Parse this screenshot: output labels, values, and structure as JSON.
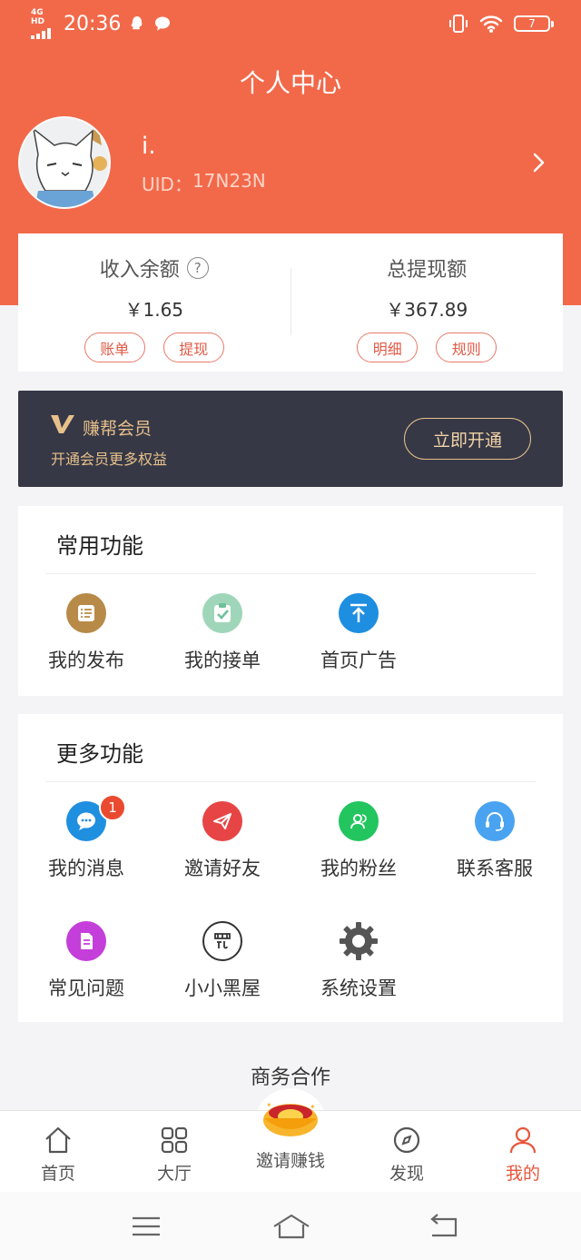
{
  "status_bar": {
    "network": "4G HD",
    "time": "20:36",
    "battery": "7"
  },
  "header": {
    "title": "个人中心"
  },
  "profile": {
    "name": "i.",
    "uid_label": "UID：",
    "uid": "17N23N"
  },
  "balance": {
    "income_label": "收入余额",
    "income_value": "￥1.65",
    "income_btn_bill": "账单",
    "income_btn_withdraw": "提现",
    "total_label": "总提现额",
    "total_value": "￥367.89",
    "total_btn_detail": "明细",
    "total_btn_rules": "规则"
  },
  "vip": {
    "title": "赚帮会员",
    "subtitle": "开通会员更多权益",
    "button": "立即开通"
  },
  "common": {
    "title": "常用功能",
    "items": [
      {
        "label": "我的发布",
        "icon": "list-icon",
        "color": "#b88a48"
      },
      {
        "label": "我的接单",
        "icon": "clipboard-check-icon",
        "color": "#6fc09b"
      },
      {
        "label": "首页广告",
        "icon": "pin-top-icon",
        "color": "#1e8ee0"
      }
    ]
  },
  "more": {
    "title": "更多功能",
    "items": [
      {
        "label": "我的消息",
        "icon": "message-icon",
        "color": "#1f8fe0",
        "badge": "1"
      },
      {
        "label": "邀请好友",
        "icon": "paper-plane-icon",
        "color": "#e74545"
      },
      {
        "label": "我的粉丝",
        "icon": "user-group-icon",
        "color": "#22c55e"
      },
      {
        "label": "联系客服",
        "icon": "headset-icon",
        "color": "#4aa3f0"
      },
      {
        "label": "常见问题",
        "icon": "document-icon",
        "color": "#c43fd9"
      },
      {
        "label": "小小黑屋",
        "icon": "penalty-icon",
        "color": "#333333"
      },
      {
        "label": "系统设置",
        "icon": "gear-icon",
        "color": "#555555"
      }
    ]
  },
  "business": {
    "title": "商务合作"
  },
  "tabbar": {
    "home": "首页",
    "hall": "大厅",
    "invite": "邀请赚钱",
    "discover": "发现",
    "mine": "我的"
  },
  "colors": {
    "primary": "#f2694a",
    "vip_bg": "#363846",
    "vip_gold": "#e7c08b"
  }
}
